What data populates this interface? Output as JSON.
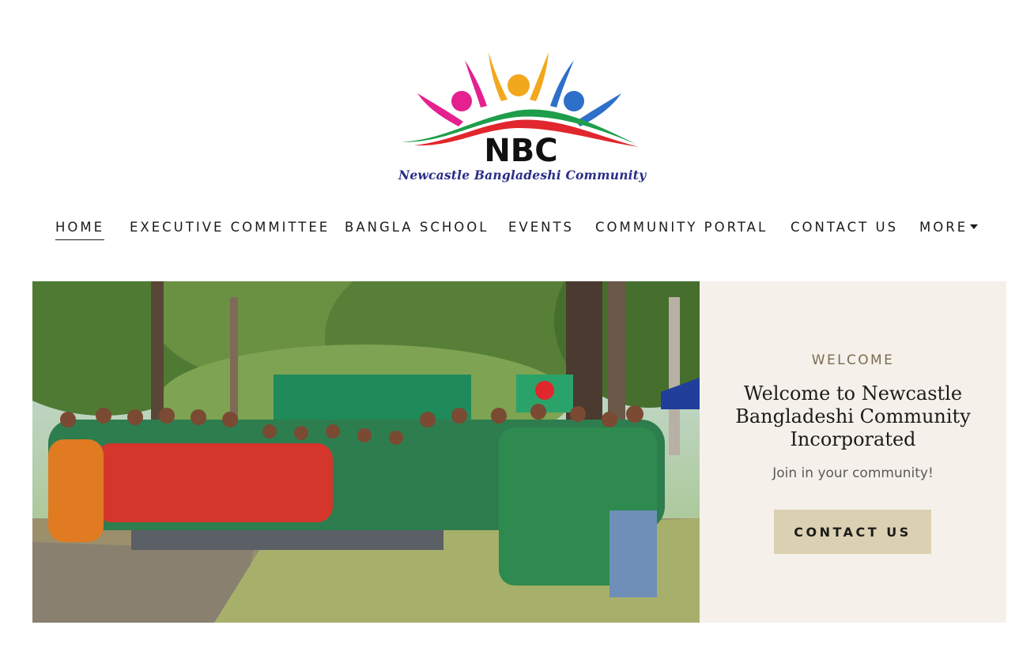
{
  "brand": {
    "logo_text": "NBC",
    "tagline": "Newcastle Bangladeshi Community"
  },
  "nav": {
    "items": [
      {
        "label": "HOME"
      },
      {
        "label": "EXECUTIVE COMMITTEE"
      },
      {
        "label": "BANGLA SCHOOL"
      },
      {
        "label": "EVENTS"
      },
      {
        "label": "COMMUNITY PORTAL"
      },
      {
        "label": "CONTACT US"
      },
      {
        "label": "MORE"
      }
    ],
    "active": "HOME"
  },
  "hero": {
    "eyebrow": "WELCOME",
    "heading": "Welcome to Newcastle Bangladeshi Community Incorporated",
    "subheading": "Join in your community!",
    "cta_label": "CONTACT US"
  },
  "colors": {
    "panel_bg": "#f5f1ea",
    "cta_bg": "#dbd0b1",
    "tagline": "#2a2f86",
    "text": "#1b1b1b"
  }
}
